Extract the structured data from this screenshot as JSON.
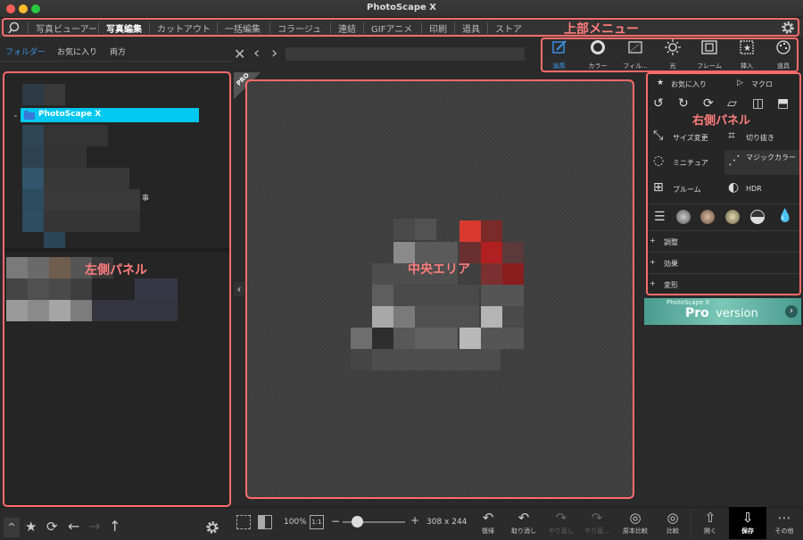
{
  "window": {
    "title": "PhotoScape X"
  },
  "top_menu": {
    "items": [
      "写真ビューアー",
      "写真編集",
      "カットアウト",
      "一括編集",
      "コラージュ",
      "連結",
      "GIFアニメ",
      "印刷",
      "道具",
      "ストア"
    ],
    "active": "写真編集",
    "annotation": "上部メニュー"
  },
  "left_panel": {
    "tabs": [
      "フォルダー",
      "お気に入り",
      "両方"
    ],
    "active_tab": "フォルダー",
    "tree_selected": "PhotoScape X",
    "tree_fragment": "事",
    "annotation": "左側パネル"
  },
  "center": {
    "annotation": "中央エリア",
    "badge": "PRO"
  },
  "tools": [
    {
      "label": "編集",
      "icon": "pencil-icon"
    },
    {
      "label": "カラー",
      "icon": "color-ring-icon"
    },
    {
      "label": "フィル...",
      "icon": "film-icon"
    },
    {
      "label": "光",
      "icon": "sun-icon"
    },
    {
      "label": "フレーム",
      "icon": "frame-icon"
    },
    {
      "label": "挿入",
      "icon": "insert-icon"
    },
    {
      "label": "道具",
      "icon": "palette-icon"
    }
  ],
  "right_panel": {
    "favorites": "お気に入り",
    "macro": "マクロ",
    "annotation": "右側パネル",
    "functions": [
      "サイズ変更",
      "切り抜き",
      "ミニチュア",
      "マジックカラー",
      "ブルーム",
      "HDR"
    ],
    "accordions": [
      "調整",
      "効果",
      "変形"
    ]
  },
  "pro_banner": {
    "small": "PhotoScape X",
    "big_pro": "Pro",
    "big_version": " version"
  },
  "bottom": {
    "zoom": "100%",
    "one_to_one": "1:1",
    "image_size": "308 x 244",
    "actions": [
      {
        "label": "復帰",
        "icon": "revert-icon",
        "enabled": true
      },
      {
        "label": "取り消し",
        "icon": "undo-icon",
        "enabled": true
      },
      {
        "label": "やり直し",
        "icon": "redo-icon",
        "enabled": false
      },
      {
        "label": "やり直...",
        "icon": "redo-all-icon",
        "enabled": false
      },
      {
        "label": "原本比較",
        "icon": "compare-original-icon",
        "enabled": true
      },
      {
        "label": "比較",
        "icon": "compare-icon",
        "enabled": true
      },
      {
        "label": "開く",
        "icon": "open-icon",
        "enabled": true
      },
      {
        "label": "保存",
        "icon": "save-icon",
        "enabled": true
      },
      {
        "label": "その他",
        "icon": "more-icon",
        "enabled": true
      }
    ]
  },
  "colors": {
    "annotation_red": "#ff6b6b",
    "selection_cyan": "#00c8f0",
    "accent_blue": "#3a8fe0"
  }
}
